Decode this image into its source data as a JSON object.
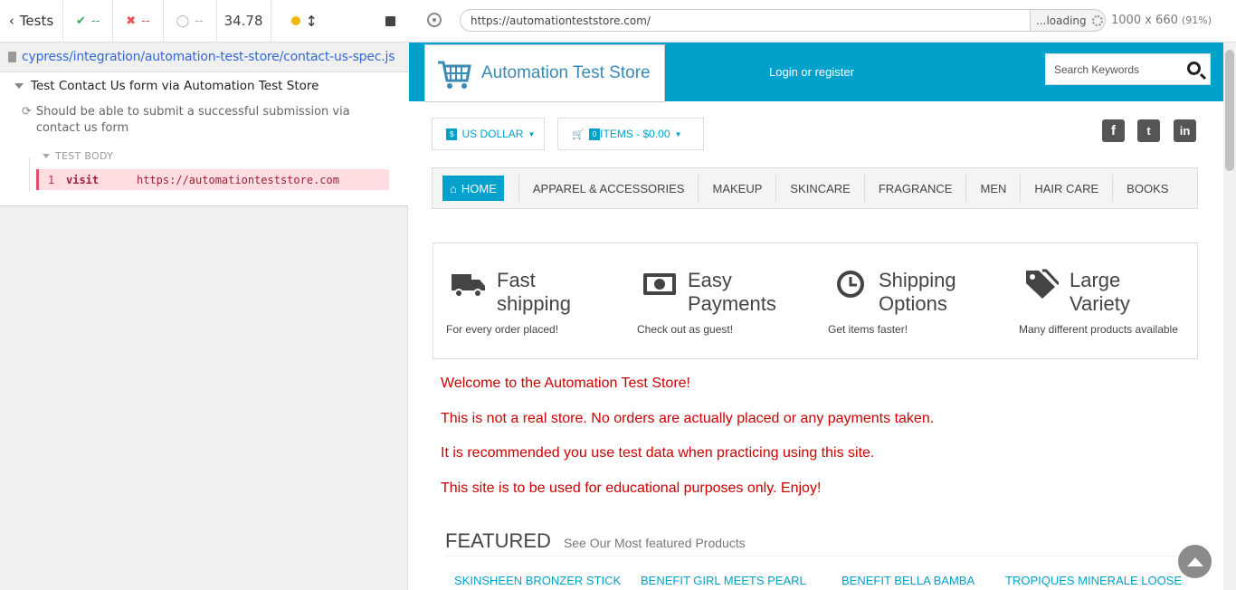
{
  "runner": {
    "tests_label": "Tests",
    "passed": "--",
    "failed": "--",
    "pending": "--",
    "duration": "34.78",
    "spec_path": "cypress/integration/automation-test-store/contact-us-spec.js",
    "suite_title": "Test Contact Us form via Automation Test Store",
    "test_title": "Should be able to submit a successful submission via contact us form",
    "test_body_label": "TEST BODY",
    "command": {
      "number": "1",
      "name": "visit",
      "message": "https://automationteststore.com"
    }
  },
  "browser": {
    "url": "https://automationteststore.com/",
    "loading_label": "...loading",
    "viewport_size": "1000 x 660",
    "viewport_scale": "(91%)"
  },
  "site": {
    "logo_text": "Automation Test Store",
    "login_label": "Login or register",
    "search_placeholder": "Search Keywords",
    "currency_badge": "$",
    "currency_label": "US DOLLAR",
    "cart_badge": "0",
    "cart_label": "ITEMS - $0.00",
    "social": [
      "f",
      "t",
      "in"
    ],
    "nav": {
      "home": "HOME",
      "items": [
        "APPAREL & ACCESSORIES",
        "MAKEUP",
        "SKINCARE",
        "FRAGRANCE",
        "MEN",
        "HAIR CARE",
        "BOOKS"
      ]
    },
    "features": [
      {
        "title_1": "Fast",
        "title_2": "shipping",
        "subtitle": "For every order placed!",
        "icon": "truck-icon"
      },
      {
        "title_1": "Easy",
        "title_2": "Payments",
        "subtitle": "Check out as guest!",
        "icon": "banknote-icon"
      },
      {
        "title_1": "Shipping",
        "title_2": "Options",
        "subtitle": "Get items faster!",
        "icon": "clock-icon"
      },
      {
        "title_1": "Large",
        "title_2": "Variety",
        "subtitle": "Many different products available",
        "icon": "tags-icon"
      }
    ],
    "welcome": [
      "Welcome to the Automation Test Store!",
      "This is not a real store. No orders are actually placed or any payments taken.",
      "It is recommended you use test data when practicing using this site.",
      "This site is to be used for educational purposes only. Enjoy!"
    ],
    "featured_heading": "FEATURED",
    "featured_sub": "See Our Most featured Products",
    "products": [
      "SKINSHEEN BRONZER STICK",
      "BENEFIT GIRL MEETS PEARL",
      "BENEFIT BELLA BAMBA",
      "TROPIQUES MINERALE LOOSE"
    ],
    "accent_color": "#00a1cb",
    "notice_color": "#cc0000"
  }
}
